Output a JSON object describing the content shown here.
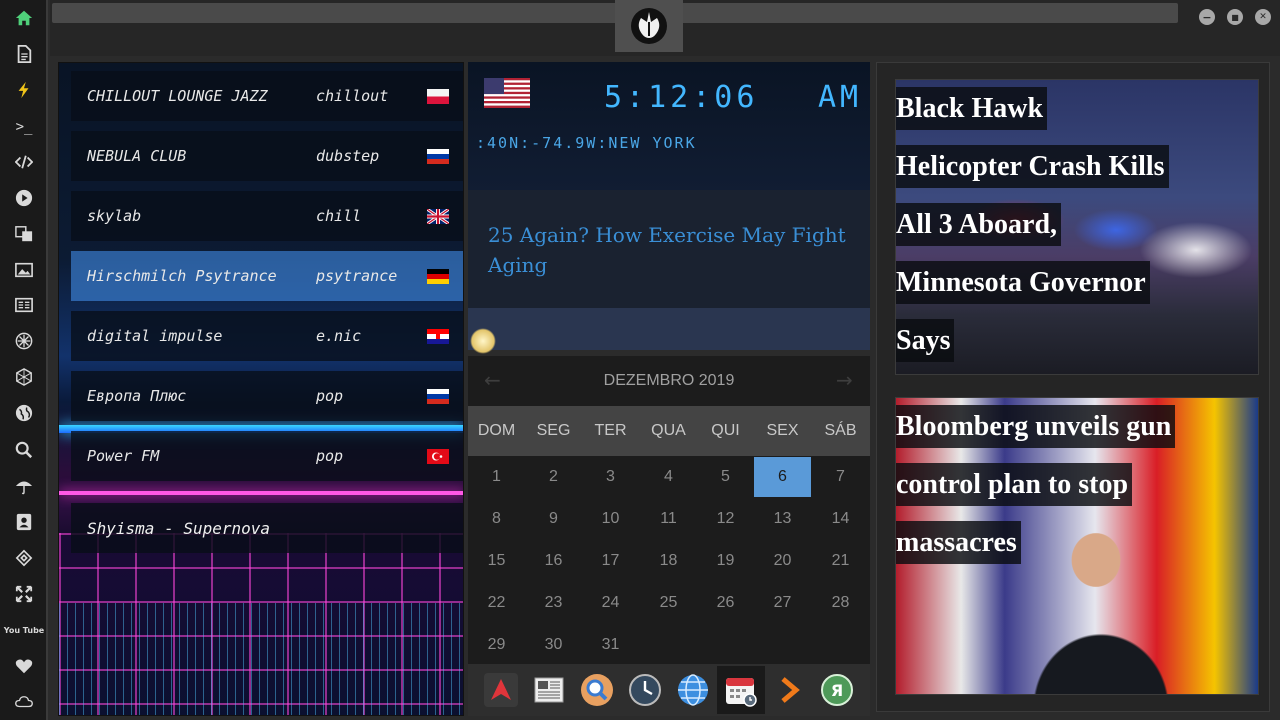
{
  "sidebar": {
    "icons": [
      "home-icon",
      "document-icon",
      "bolt-icon",
      "terminal-icon",
      "code-icon",
      "play-icon",
      "translate-icon",
      "image-icon",
      "news-icon",
      "rebel-icon",
      "hexagon-icon",
      "globe-icon",
      "search-icon",
      "umbrella-icon",
      "contact-icon",
      "link-icon",
      "expand-icon",
      "youtube-icon",
      "heart-icon",
      "cloud-icon"
    ],
    "terminal_glyph": ">_",
    "youtube_text": "You Tube"
  },
  "topbar": {
    "emblem": "rebel-alliance-emblem"
  },
  "radio": {
    "stations": [
      {
        "name": "CHILLOUT LOUNGE JAZZ",
        "genre": "chillout",
        "flag": "poland"
      },
      {
        "name": "NEBULA CLUB",
        "genre": "dubstep",
        "flag": "russia"
      },
      {
        "name": "skylab",
        "genre": "chill",
        "flag": "uk"
      },
      {
        "name": "Hirschmilch Psytrance",
        "genre": "psytrance",
        "flag": "germany"
      },
      {
        "name": "digital impulse",
        "genre": "e.nic",
        "flag": "croatia"
      },
      {
        "name": "Европа Плюс",
        "genre": "pop",
        "flag": "russia"
      },
      {
        "name": "Power FM",
        "genre": "pop",
        "flag": "turkey"
      }
    ],
    "active_index": 3,
    "now_playing": "Shyisma - Supernova"
  },
  "clock": {
    "time": "5:12:06",
    "ampm": "AM",
    "location": ":40N:-74.9W:NEW YORK",
    "flag": "usa"
  },
  "article": {
    "headline": "25 Again? How Exercise May Fight Aging"
  },
  "calendar": {
    "title": "DEZEMBRO 2019",
    "prev": "←",
    "next": "→",
    "weekdays": [
      "DOM",
      "SEG",
      "TER",
      "QUA",
      "QUI",
      "SEX",
      "SÁB"
    ],
    "days": [
      "1",
      "2",
      "3",
      "4",
      "5",
      "6",
      "7",
      "8",
      "9",
      "10",
      "11",
      "12",
      "13",
      "14",
      "15",
      "16",
      "17",
      "18",
      "19",
      "20",
      "21",
      "22",
      "23",
      "24",
      "25",
      "26",
      "27",
      "28",
      "29",
      "30",
      "31"
    ],
    "today": "6"
  },
  "dock": {
    "icons": [
      "arch-icon",
      "newspaper-icon",
      "search-icon",
      "clock-icon",
      "globe-icon",
      "calendar-icon",
      "play-arrow-icon",
      "yandex-icon"
    ],
    "selected": "calendar-icon",
    "yandex_glyph": "Я"
  },
  "news": {
    "items": [
      {
        "headline_lines": [
          "Black Hawk",
          "Helicopter Crash Kills",
          "All 3 Aboard,",
          "Minnesota Governor",
          "Says"
        ]
      },
      {
        "headline_lines": [
          "Bloomberg unveils gun",
          "control plan to stop",
          "massacres"
        ]
      }
    ]
  },
  "window": {
    "minimize": "−",
    "maximize": "■",
    "close": "✕"
  },
  "colors": {
    "accent": "#5a9ad8",
    "clock": "#43b7ff",
    "headline_link": "#3a8fd6"
  }
}
